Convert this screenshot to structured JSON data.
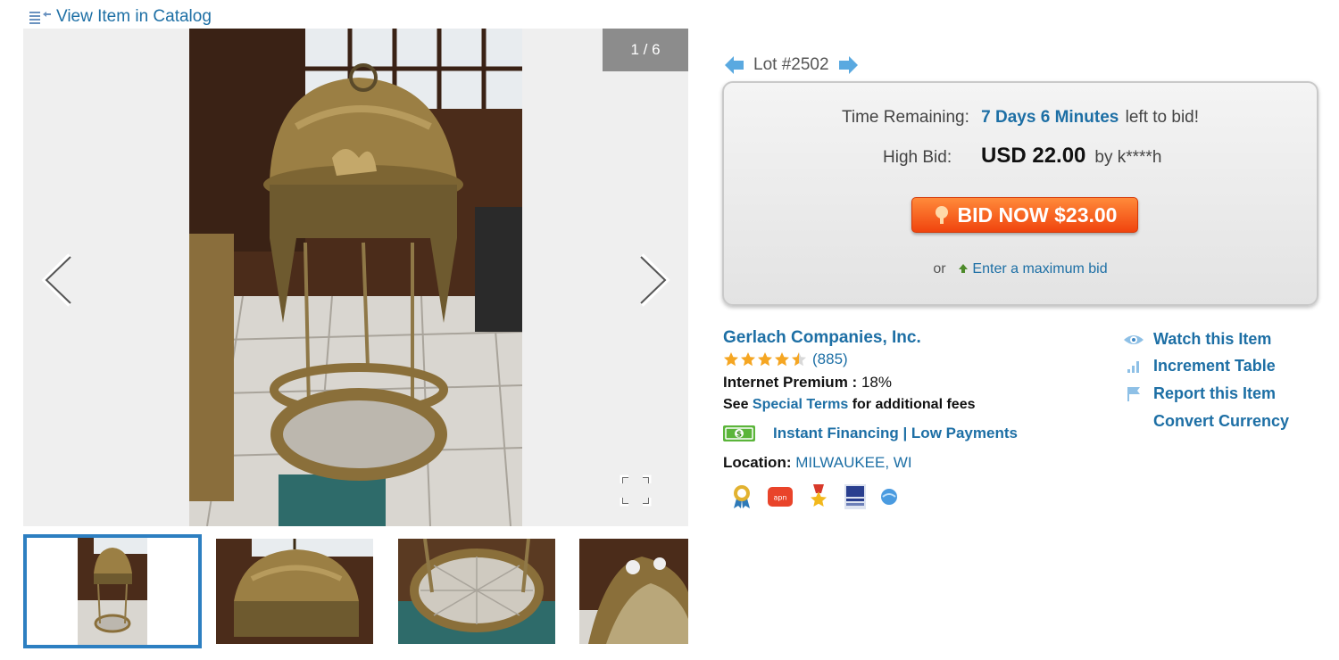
{
  "catalog": {
    "link_label": "View Item in Catalog",
    "icon": "list-back-icon"
  },
  "viewer": {
    "counter": "1 / 6",
    "prev_icon": "chevron-left-icon",
    "next_icon": "chevron-right-icon",
    "fullscreen_icon": "fullscreen-icon",
    "thumbnail_count": 4,
    "selected_thumbnail": 1
  },
  "lot": {
    "label": "Lot #2502",
    "prev_icon": "arrow-left-icon",
    "next_icon": "arrow-right-icon"
  },
  "bid": {
    "time_label": "Time Remaining:",
    "time_value": "7 Days 6 Minutes",
    "time_suffix": "left to bid!",
    "high_bid_label": "High Bid:",
    "high_bid_amount": "USD 22.00",
    "high_bid_by": "by k****h",
    "button_label": "BID NOW $23.00",
    "or_label": "or",
    "max_bid_label": "Enter a maximum bid"
  },
  "seller": {
    "name": "Gerlach Companies, Inc.",
    "rating_stars": 4.5,
    "rating_count": "(885)",
    "premium_label": "Internet Premium :",
    "premium_value": "18%",
    "terms_prefix": "See",
    "terms_link": "Special Terms",
    "terms_suffix": "for additional fees",
    "financing_label": "Instant Financing | Low Payments",
    "location_label": "Location:",
    "location_value": "MILWAUKEE, WI",
    "badges": [
      "award-ribbon-icon",
      "apn-badge-icon",
      "medal-star-icon",
      "association-badge-icon",
      "globe-badge-icon"
    ]
  },
  "actions": {
    "watch": "Watch this Item",
    "increment": "Increment Table",
    "report": "Report this Item",
    "currency": "Convert Currency"
  },
  "colors": {
    "link": "#1d6fa5",
    "bid_button": "#f0440e",
    "thumb_border": "#2d7fc1"
  }
}
